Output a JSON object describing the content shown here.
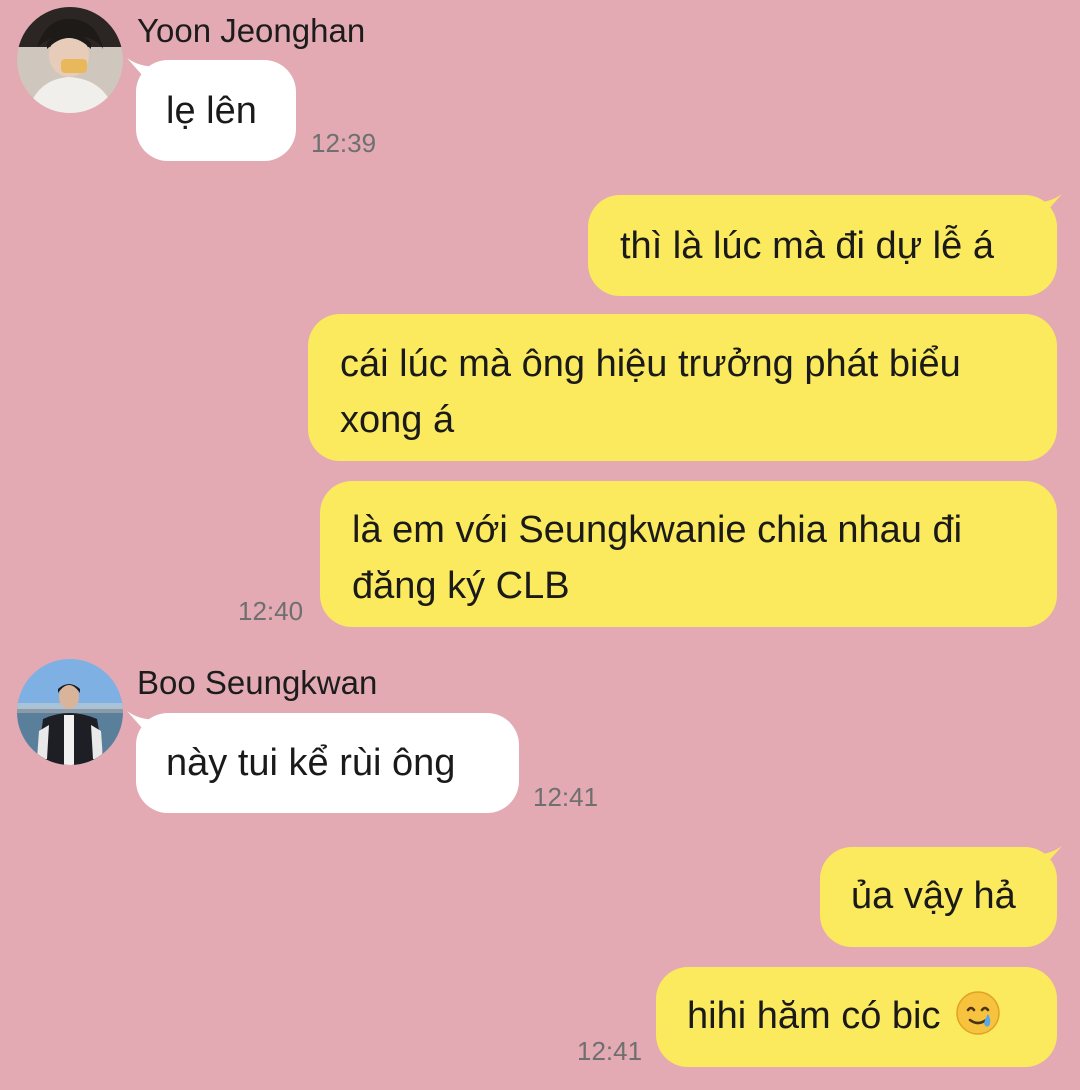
{
  "colors": {
    "background": "#e3aab3",
    "incoming_bubble": "#ffffff",
    "outgoing_bubble": "#fbe95e"
  },
  "messages": {
    "jeonghan": {
      "sender": "Yoon Jeonghan",
      "text": "lẹ lên",
      "time": "12:39"
    },
    "me_1": {
      "text": "thì là lúc mà đi dự lễ á"
    },
    "me_2": {
      "line1": "cái lúc mà ông hiệu trưởng phát biểu",
      "line2": "xong á"
    },
    "me_3": {
      "line1": "là em với Seungkwanie chia nhau đi",
      "line2": "đăng ký CLB",
      "time": "12:40"
    },
    "seungkwan": {
      "sender": "Boo Seungkwan",
      "text": "này tui kể rùi ông",
      "time": "12:41"
    },
    "me_4": {
      "text": "ủa vậy hả"
    },
    "me_5": {
      "text": "hihi hăm có bic",
      "emoji": "crying-smile-emoji",
      "time": "12:41"
    }
  }
}
